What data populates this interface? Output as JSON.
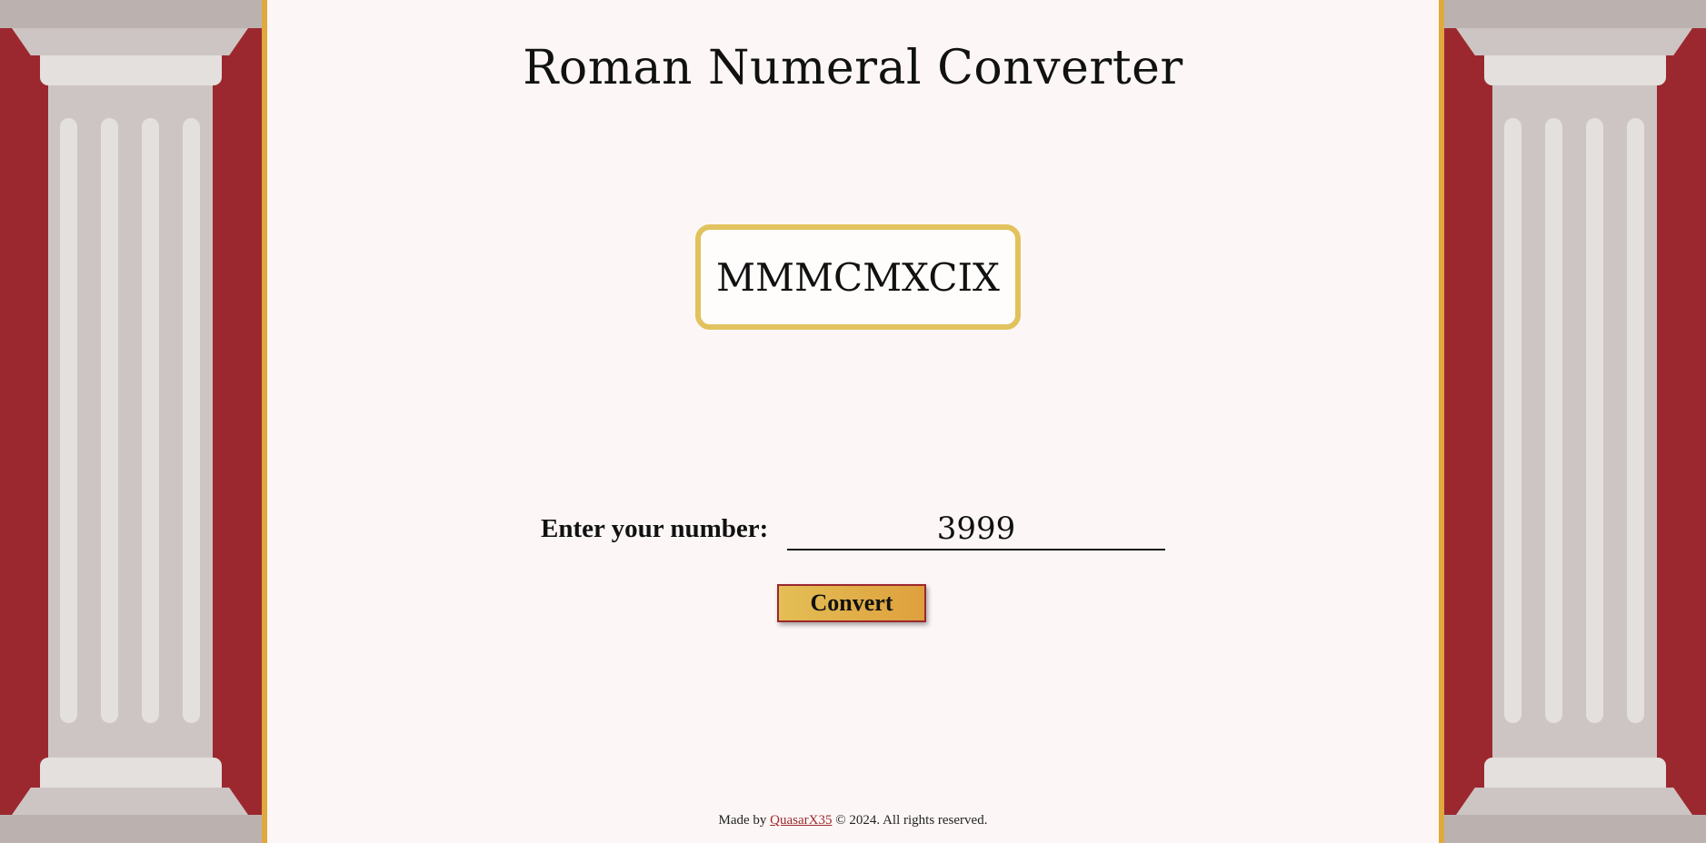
{
  "page": {
    "title": "Roman Numeral Converter"
  },
  "output": {
    "value": "MMMCMXCIX"
  },
  "form": {
    "label": "Enter your number:",
    "input_value": "3999",
    "button_label": "Convert"
  },
  "footer": {
    "prefix": "Made by",
    "author_link": "QuasarX35",
    "suffix": "© 2024. All rights reserved."
  },
  "colors": {
    "crimson": "#9c282f",
    "gold": "#e1a83e",
    "output_border": "#e1c25e",
    "panel_bg": "#fcf7f6",
    "column_stone": "#cdc5c3"
  }
}
